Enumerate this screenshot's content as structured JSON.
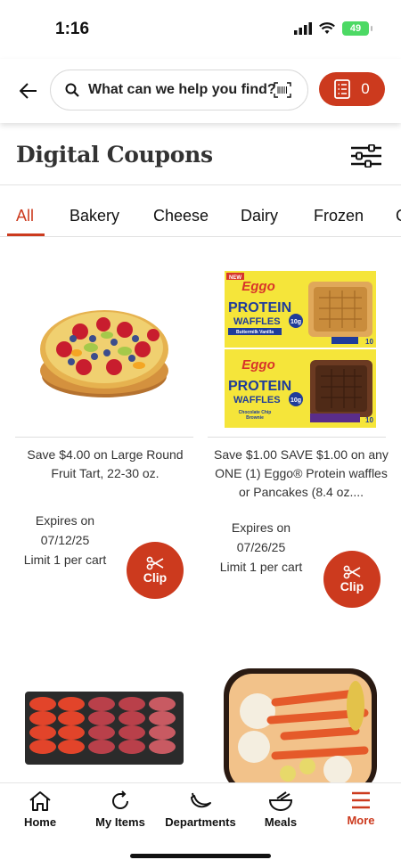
{
  "status": {
    "time": "1:16",
    "battery": "49"
  },
  "header": {
    "search_placeholder": "What can we help you find?",
    "list_count": "0"
  },
  "page": {
    "title": "Digital Coupons"
  },
  "tabs": [
    {
      "label": "All"
    },
    {
      "label": "Bakery"
    },
    {
      "label": "Cheese"
    },
    {
      "label": "Dairy"
    },
    {
      "label": "Frozen"
    }
  ],
  "coupons": [
    {
      "description": "Save $4.00 on Large Round Fruit Tart, 22-30 oz.",
      "expires_label": "Expires on",
      "expires_date": "07/12/25",
      "limit": "Limit 1 per cart",
      "clip_label": "Clip"
    },
    {
      "description": "Save $1.00 SAVE $1.00 on any ONE (1) Eggo® Protein waffles or Pancakes (8.4 oz....",
      "expires_label": "Expires on",
      "expires_date": "07/26/25",
      "limit": "Limit 1 per cart",
      "clip_label": "Clip",
      "product_box": {
        "brand": "Eggo",
        "new_badge": "NEW",
        "line1": "PROTEIN",
        "line2": "WAFFLES",
        "protein_badge": "10g",
        "flavor_top": "Buttermilk Vanilla",
        "flavor_bottom_1": "Chocolate Chip",
        "flavor_bottom_2": "Brownie",
        "count": "10"
      }
    }
  ],
  "nav": [
    {
      "label": "Home",
      "icon": "home-icon"
    },
    {
      "label": "My Items",
      "icon": "refresh-icon"
    },
    {
      "label": "Departments",
      "icon": "banana-icon"
    },
    {
      "label": "Meals",
      "icon": "bowl-icon"
    },
    {
      "label": "More",
      "icon": "menu-icon"
    }
  ],
  "colors": {
    "accent": "#cc3a1e",
    "battery": "#4cd964"
  }
}
